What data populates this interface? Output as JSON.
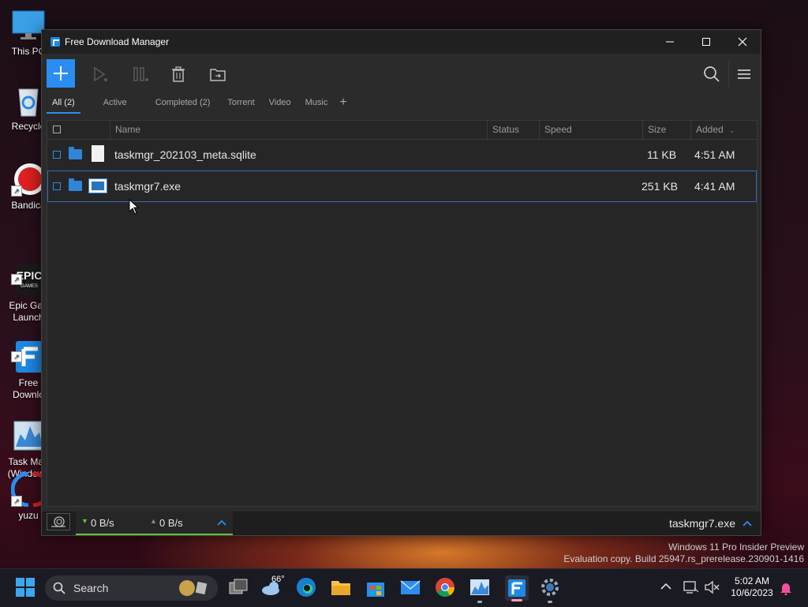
{
  "desktop": {
    "icons": [
      {
        "label": "This PC",
        "icon": "monitor-icon"
      },
      {
        "label": "Recycle",
        "icon": "recycle-bin-icon"
      },
      {
        "label": "Bandica",
        "icon": "record-icon"
      },
      {
        "label": "Epic Gan\nLaunch",
        "icon": "epic-games-icon"
      },
      {
        "label": "Free\nDownlo",
        "icon": "fdm-icon"
      },
      {
        "label": "Task Man\n(Windows",
        "icon": "task-manager-icon"
      },
      {
        "label": "yuzu",
        "icon": "yuzu-icon"
      }
    ]
  },
  "window": {
    "title": "Free Download Manager",
    "controls": {
      "minimize": "—",
      "maximize": "☐",
      "close": "✕"
    },
    "toolbar": {
      "add_icon": "plus-icon",
      "resume_icon": "play-icon",
      "pause_icon": "pause-icon",
      "delete_icon": "trash-icon",
      "move_icon": "folder-move-icon",
      "search_icon": "search-icon",
      "menu_icon": "hamburger-icon"
    },
    "tabs": [
      {
        "label": "All (2)",
        "active": true
      },
      {
        "label": "Active",
        "active": false
      },
      {
        "label": "Completed (2)",
        "active": false
      },
      {
        "label": "Torrent",
        "active": false
      },
      {
        "label": "Video",
        "active": false
      },
      {
        "label": "Music",
        "active": false
      }
    ],
    "tab_add_label": "+",
    "columns": {
      "name": "Name",
      "status": "Status",
      "speed": "Speed",
      "size": "Size",
      "added": "Added",
      "added_sort": "⌄"
    },
    "downloads": [
      {
        "name": "taskmgr_202103_meta.sqlite",
        "status": "",
        "speed": "",
        "size": "11 KB",
        "added": "4:51 AM",
        "selected": false
      },
      {
        "name": "taskmgr7.exe",
        "status": "",
        "speed": "",
        "size": "251 KB",
        "added": "4:41 AM",
        "selected": true
      }
    ],
    "statusbar": {
      "download_speed": "0 B/s",
      "upload_speed": "0 B/s",
      "current_file": "taskmgr7.exe"
    }
  },
  "watermark": {
    "line1": "Windows 11 Pro Insider Preview",
    "line2": "Evaluation copy. Build 25947.rs_prerelease.230901-1416"
  },
  "taskbar": {
    "search_label": "Search",
    "weather_temp": "66°",
    "time": "5:02 AM",
    "date": "10/6/2023"
  },
  "colors": {
    "accent": "#2a8df2",
    "speed_bar": "#5ec33a",
    "window_bg": "#2b2b2b"
  }
}
